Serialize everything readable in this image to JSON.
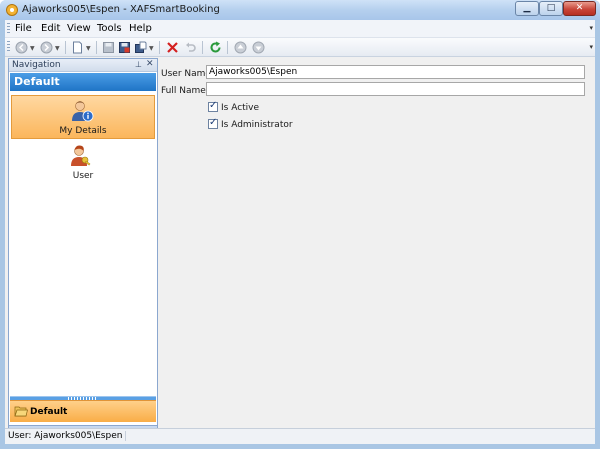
{
  "window": {
    "title": "Ajaworks005\\Espen - XAFSmartBooking",
    "min_glyph": "▁",
    "max_glyph": "□",
    "close_glyph": "✕"
  },
  "menu": {
    "items": [
      "File",
      "Edit",
      "View",
      "Tools",
      "Help"
    ],
    "more_glyph": "▾"
  },
  "toolbar": {
    "icons": [
      "back-icon",
      "forward-icon",
      "new-icon",
      "save-icon",
      "save-and-close-icon",
      "save-and-new-icon",
      "delete-icon",
      "undo-icon",
      "refresh-icon",
      "previous-record-icon",
      "next-record-icon"
    ]
  },
  "navigation": {
    "panel_title": "Navigation",
    "pin_glyph": "📌",
    "close_glyph": "✕",
    "group_title": "Default",
    "items": [
      {
        "label": "My Details",
        "selected": true
      },
      {
        "label": "User",
        "selected": false
      }
    ],
    "group_bar_label": "Default",
    "overflow_glyph": "»"
  },
  "detail": {
    "user_name_label": "User Name:",
    "user_name_value": "Ajaworks005\\Espen",
    "full_name_label": "Full Name:",
    "full_name_value": "",
    "is_active_label": "Is Active",
    "is_active_checked": true,
    "is_administrator_label": "Is Administrator",
    "is_administrator_checked": true
  },
  "status": {
    "text": "User: Ajaworks005\\Espen"
  },
  "colors": {
    "accent": "#1f74c6",
    "selection": "#fbb65c",
    "delete": "#d42020",
    "refresh": "#2b9a3c"
  }
}
